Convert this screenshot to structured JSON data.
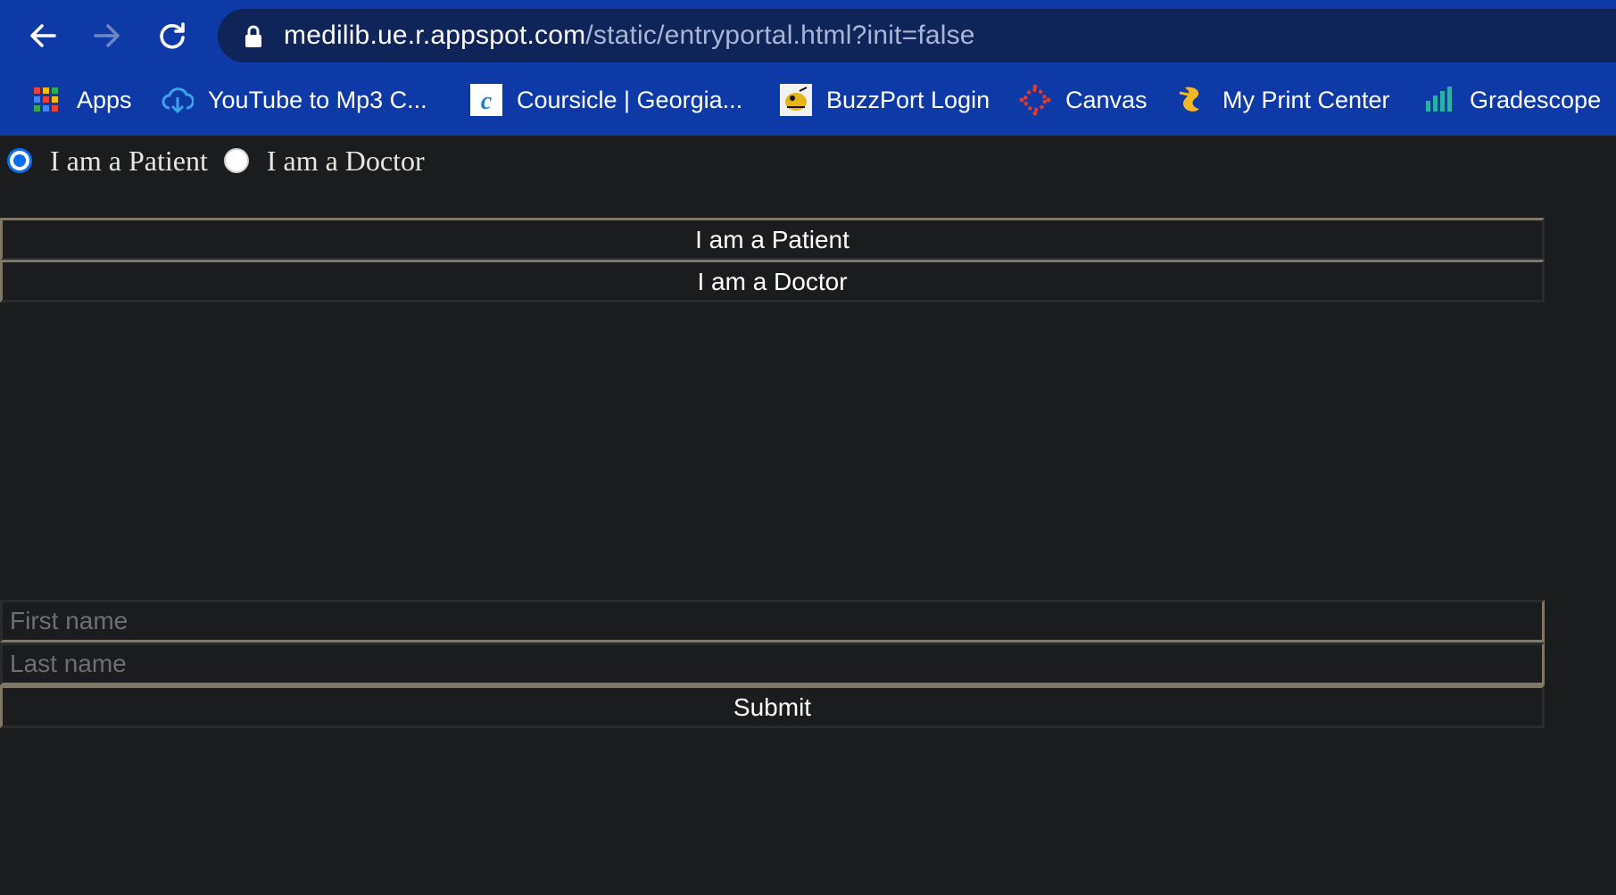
{
  "browser": {
    "url_host": "medilib.ue.r.appspot.com",
    "url_path": "/static/entryportal.html?init=false",
    "back_icon": "back-arrow-icon",
    "forward_icon": "forward-arrow-icon",
    "reload_icon": "reload-icon",
    "lock_icon": "lock-icon",
    "bookmarks": [
      {
        "label": "Apps",
        "icon": "apps-grid-icon"
      },
      {
        "label": "YouTube to Mp3 C...",
        "icon": "cloud-download-icon"
      },
      {
        "label": "Coursicle | Georgia...",
        "icon": "coursicle-icon"
      },
      {
        "label": "BuzzPort Login",
        "icon": "buzz-icon"
      },
      {
        "label": "Canvas",
        "icon": "canvas-icon"
      },
      {
        "label": "My Print Center",
        "icon": "print-center-icon"
      },
      {
        "label": "Gradescope",
        "icon": "gradescope-icon"
      }
    ],
    "colors": {
      "chrome": "#0d3aa6",
      "omnibox": "#0f2459"
    }
  },
  "page": {
    "role_radios": [
      {
        "label": "I am a Patient",
        "checked": true
      },
      {
        "label": "I am a Doctor",
        "checked": false
      }
    ],
    "patient_button": "I am a Patient",
    "doctor_button": "I am a Doctor",
    "first_name": {
      "placeholder": "First name",
      "value": ""
    },
    "last_name": {
      "placeholder": "Last name",
      "value": ""
    },
    "submit_button": "Submit",
    "colors": {
      "background": "#1b1c1e",
      "text": "#e8e6e3",
      "radio_accent": "#0b6df0"
    }
  }
}
